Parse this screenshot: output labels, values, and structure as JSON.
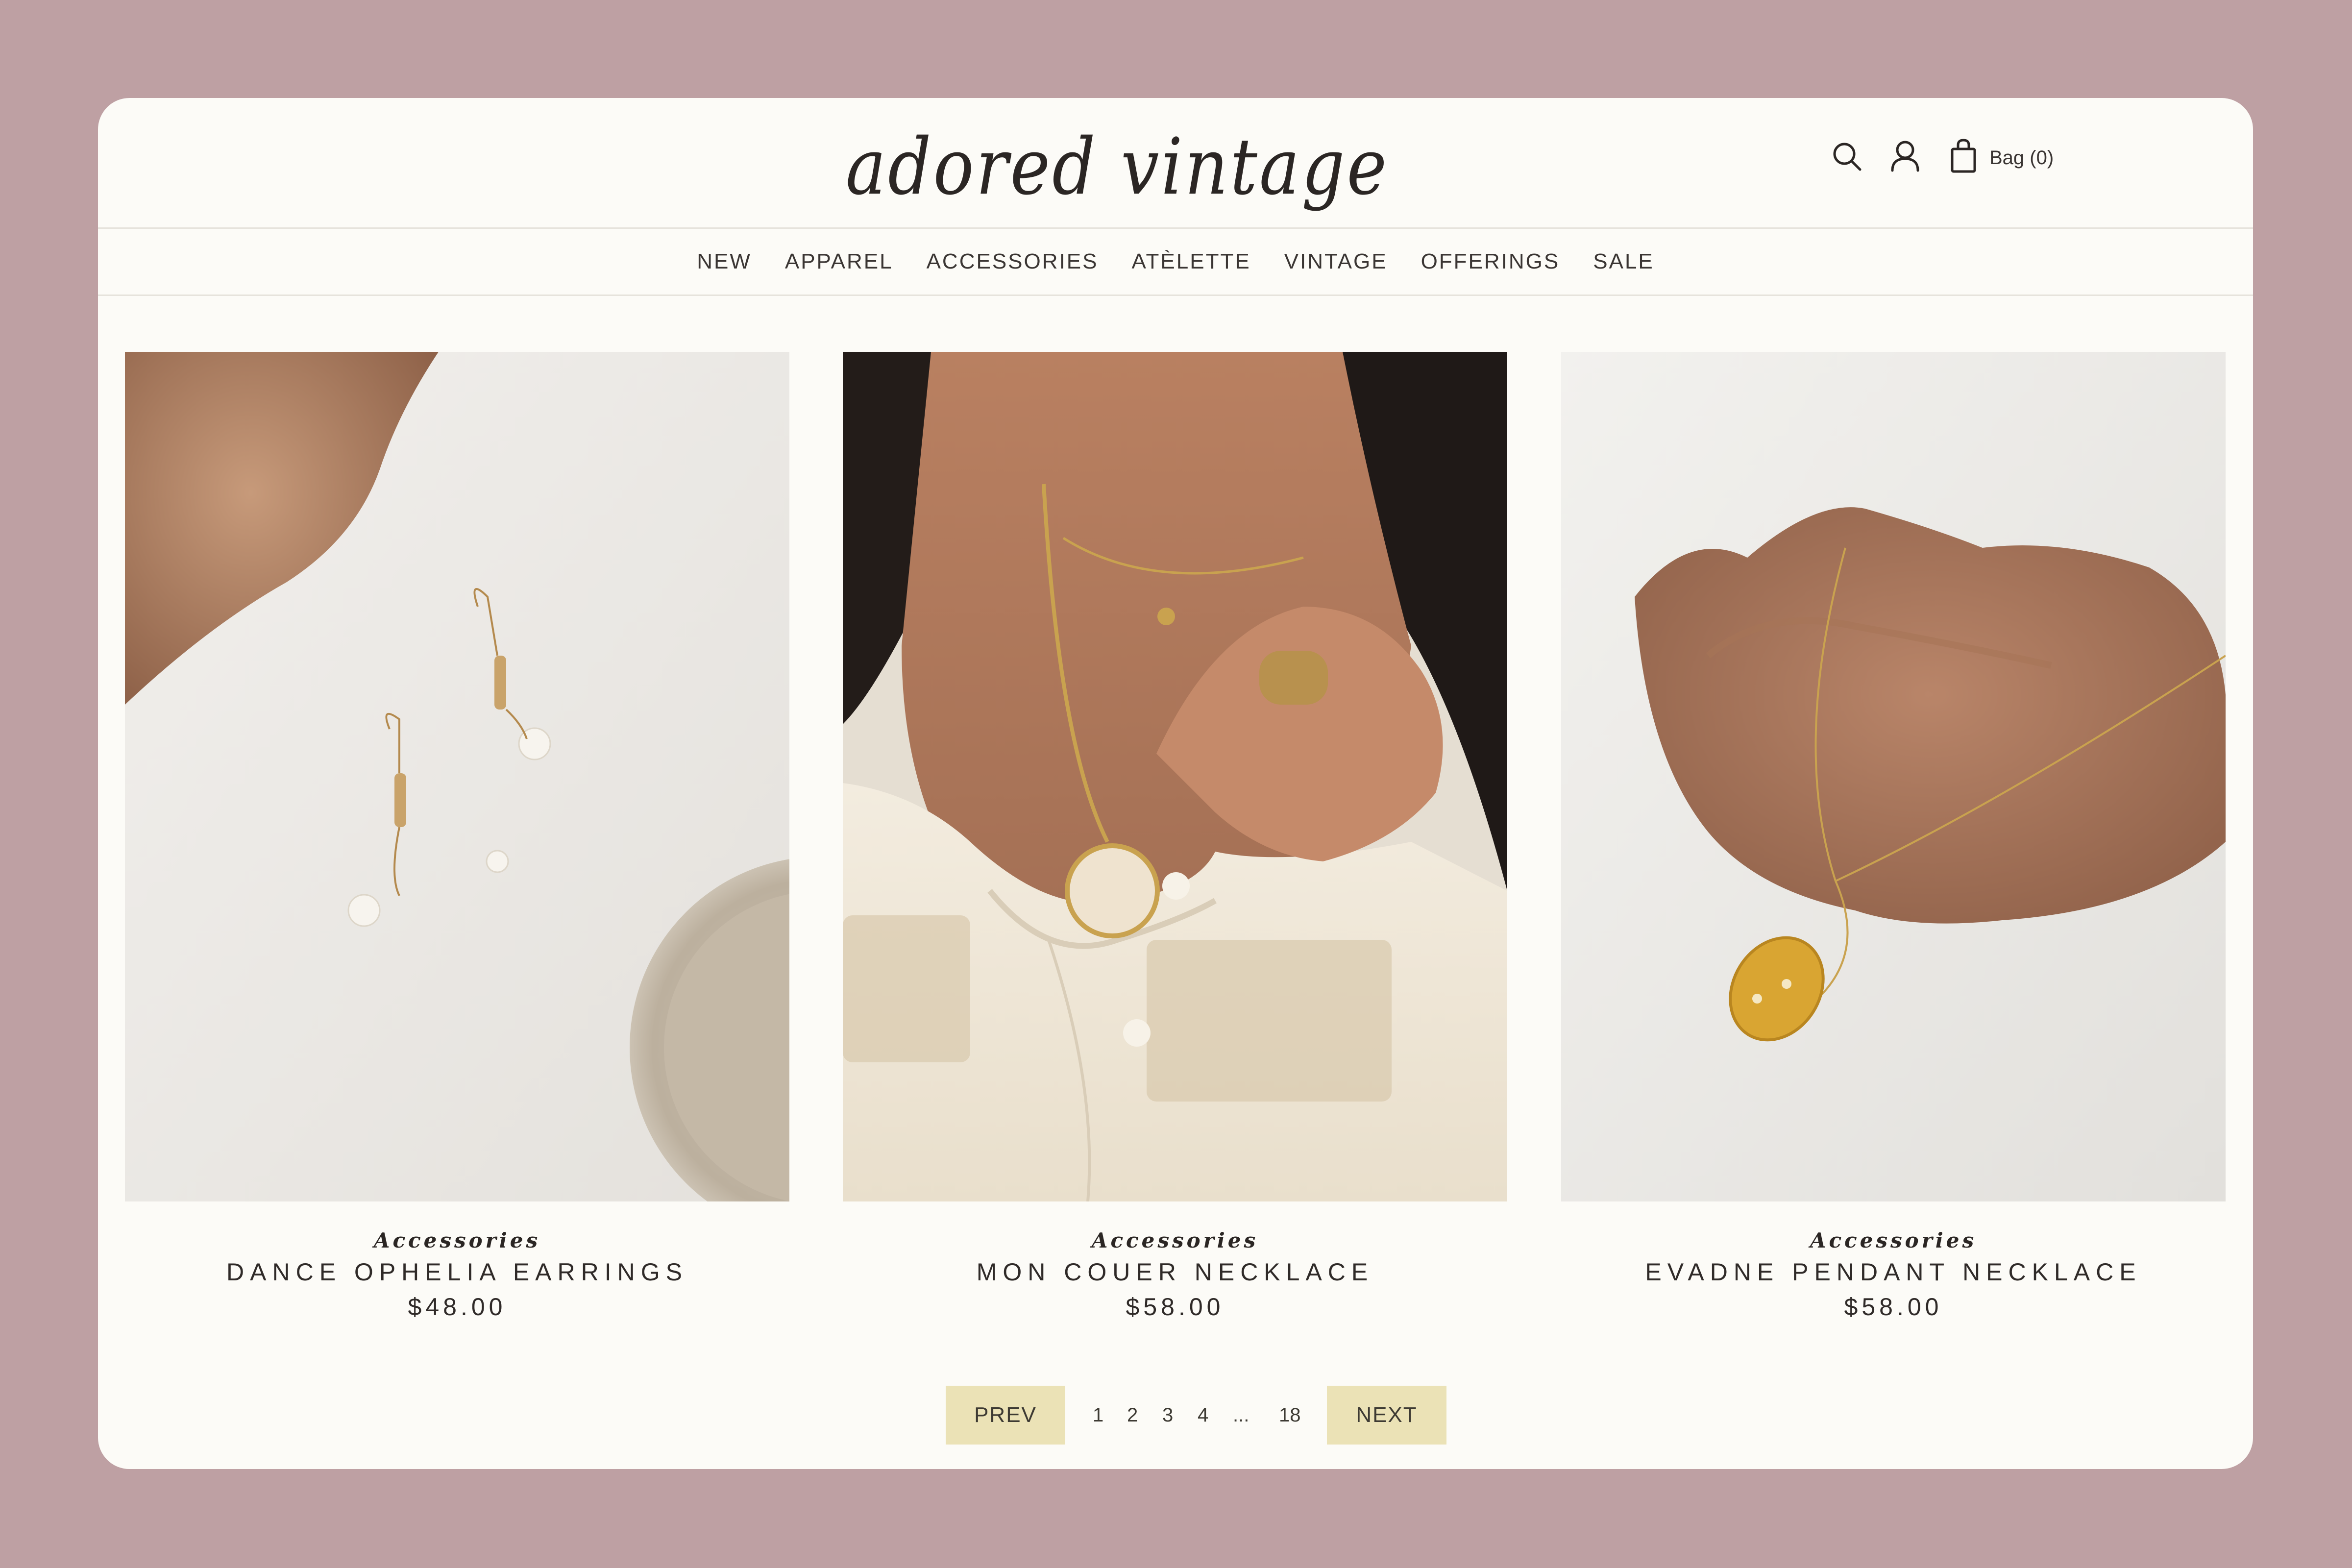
{
  "header": {
    "logo": "adored vintage",
    "bag_label": "Bag (0)",
    "icons": [
      "search-icon",
      "account-icon",
      "bag-icon"
    ]
  },
  "nav": {
    "items": [
      "NEW",
      "APPAREL",
      "ACCESSORIES",
      "ATÈLETTE",
      "VINTAGE",
      "OFFERINGS",
      "SALE"
    ]
  },
  "products": [
    {
      "category": "Accessories",
      "name": "DANCE OPHELIA EARRINGS",
      "price": "$48.00"
    },
    {
      "category": "Accessories",
      "name": "MON COUER NECKLACE",
      "price": "$58.00"
    },
    {
      "category": "Accessories",
      "name": "EVADNE PENDANT NECKLACE",
      "price": "$58.00"
    }
  ],
  "pagination": {
    "prev": "PREV",
    "next": "NEXT",
    "pages": [
      "1",
      "2",
      "3",
      "4",
      "...",
      "18"
    ]
  },
  "colors": {
    "background": "#bea0a3",
    "card": "#fcfbf7",
    "pager_button": "#ebe2b6",
    "text": "#2f2a28"
  }
}
